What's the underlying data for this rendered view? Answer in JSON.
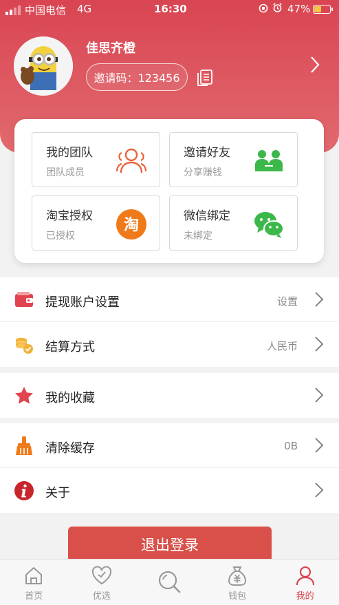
{
  "status_bar": {
    "carrier": "中国电信",
    "network": "4G",
    "time": "16:30",
    "battery": "47%",
    "battery_level": 0.47
  },
  "profile": {
    "username": "佳思齐橙",
    "invite_code": "邀请码：123456"
  },
  "quick_actions": [
    {
      "title": "我的团队",
      "subtitle": "团队成员",
      "icon": "team-icon",
      "color": "#e8623a"
    },
    {
      "title": "邀请好友",
      "subtitle": "分享赚钱",
      "icon": "friends-icon",
      "color": "#3cb84a"
    },
    {
      "title": "淘宝授权",
      "subtitle": "已授权",
      "icon": "taobao-icon",
      "color": "#f07a1a",
      "glyph": "淘"
    },
    {
      "title": "微信绑定",
      "subtitle": "未绑定",
      "icon": "wechat-icon",
      "color": "#3cb84a"
    }
  ],
  "settings": {
    "withdraw": {
      "label": "提现账户设置",
      "value": "设置",
      "icon": "wallet-icon"
    },
    "settlement": {
      "label": "结算方式",
      "value": "人民币",
      "icon": "coins-icon"
    },
    "favorites": {
      "label": "我的收藏",
      "icon": "star-icon"
    },
    "clear_cache": {
      "label": "清除缓存",
      "value": "0B",
      "icon": "broom-icon"
    },
    "about": {
      "label": "关于",
      "icon": "info-icon"
    }
  },
  "logout_label": "退出登录",
  "tabbar": [
    {
      "label": "首页",
      "icon": "home-icon",
      "active": false
    },
    {
      "label": "优选",
      "icon": "heart-icon",
      "active": false
    },
    {
      "label": "",
      "icon": "search-icon",
      "active": false
    },
    {
      "label": "钱包",
      "icon": "money-bag-icon",
      "active": false
    },
    {
      "label": "我的",
      "icon": "user-icon",
      "active": true
    }
  ],
  "colors": {
    "header": "#d94552",
    "logout": "#d85049",
    "active_tab": "#d94552"
  }
}
